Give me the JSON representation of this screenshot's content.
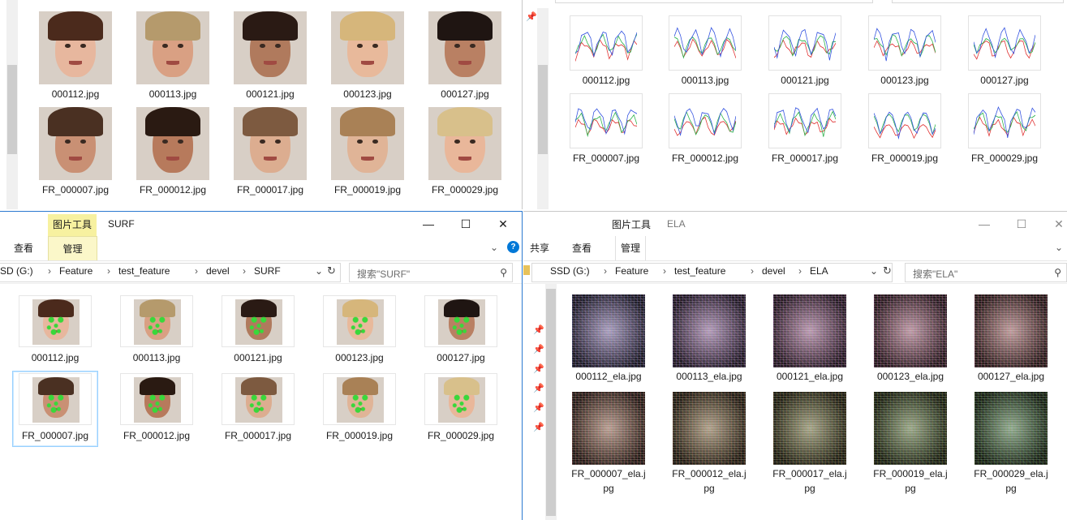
{
  "top_left": {
    "items": [
      {
        "name": "000112.jpg",
        "skin": "#e7b79e",
        "hair": "#4b2a1c"
      },
      {
        "name": "000113.jpg",
        "skin": "#d9a083",
        "hair": "#b59a6c"
      },
      {
        "name": "000121.jpg",
        "skin": "#b07a5d",
        "hair": "#2a1a14"
      },
      {
        "name": "000123.jpg",
        "skin": "#e8b99b",
        "hair": "#d6b67b"
      },
      {
        "name": "000127.jpg",
        "skin": "#b98063",
        "hair": "#1f1512"
      },
      {
        "name": "FR_000007.jpg",
        "skin": "#c99074",
        "hair": "#4a3022"
      },
      {
        "name": "FR_000012.jpg",
        "skin": "#b77a5c",
        "hair": "#2a1a12"
      },
      {
        "name": "FR_000017.jpg",
        "skin": "#dcad90",
        "hair": "#7d5a40"
      },
      {
        "name": "FR_000019.jpg",
        "skin": "#e0b497",
        "hair": "#a98156"
      },
      {
        "name": "FR_000029.jpg",
        "skin": "#e9b79a",
        "hair": "#d8c08b"
      }
    ]
  },
  "top_right": {
    "items": [
      "000112.jpg",
      "000113.jpg",
      "000121.jpg",
      "000123.jpg",
      "000127.jpg",
      "FR_000007.jpg",
      "FR_000012.jpg",
      "FR_000017.jpg",
      "FR_000019.jpg",
      "FR_000029.jpg"
    ]
  },
  "surf_window": {
    "ctx_tab": "图片工具",
    "title": "SURF",
    "ribbon": {
      "view": "查看",
      "manage": "管理"
    },
    "breadcrumb": [
      "SD (G:)",
      "Feature",
      "test_feature",
      "devel",
      "SURF"
    ],
    "search_placeholder": "搜索\"SURF\"",
    "items": [
      {
        "name": "000112.jpg",
        "skin": "#e7b79e",
        "hair": "#4b2a1c"
      },
      {
        "name": "000113.jpg",
        "skin": "#d9a083",
        "hair": "#b59a6c"
      },
      {
        "name": "000121.jpg",
        "skin": "#b07a5d",
        "hair": "#2a1a14"
      },
      {
        "name": "000123.jpg",
        "skin": "#e8b99b",
        "hair": "#d6b67b"
      },
      {
        "name": "000127.jpg",
        "skin": "#b98063",
        "hair": "#1f1512"
      },
      {
        "name": "FR_000007.jpg",
        "skin": "#c99074",
        "hair": "#4a3022",
        "selected": true
      },
      {
        "name": "FR_000012.jpg",
        "skin": "#b77a5c",
        "hair": "#2a1a12"
      },
      {
        "name": "FR_000017.jpg",
        "skin": "#dcad90",
        "hair": "#7d5a40"
      },
      {
        "name": "FR_000019.jpg",
        "skin": "#e0b497",
        "hair": "#a98156"
      },
      {
        "name": "FR_000029.jpg",
        "skin": "#e9b79a",
        "hair": "#d8c08b"
      }
    ]
  },
  "ela_window": {
    "ctx_tab": "图片工具",
    "title": "ELA",
    "ribbon": {
      "share": "共享",
      "view": "查看",
      "manage": "管理"
    },
    "breadcrumb": [
      "SSD (G:)",
      "Feature",
      "test_feature",
      "devel",
      "ELA"
    ],
    "search_placeholder": "搜索\"ELA\"",
    "items": [
      [
        "000112_ela.jpg"
      ],
      [
        "000113_ela.jpg"
      ],
      [
        "000121_ela.jpg"
      ],
      [
        "000123_ela.jpg"
      ],
      [
        "000127_ela.jpg"
      ],
      [
        "FR_000007_ela.j",
        "pg"
      ],
      [
        "FR_000012_ela.j",
        "pg"
      ],
      [
        "FR_000017_ela.j",
        "pg"
      ],
      [
        "FR_000019_ela.j",
        "pg"
      ],
      [
        "FR_000029_ela.j",
        "pg"
      ]
    ]
  },
  "nav_prev": "«",
  "refresh": "↻",
  "search_icon": "⚲",
  "colors": {
    "accent": "#0078d7",
    "ctx_tab": "#f7f1a0",
    "select_border": "#99d1ff"
  }
}
